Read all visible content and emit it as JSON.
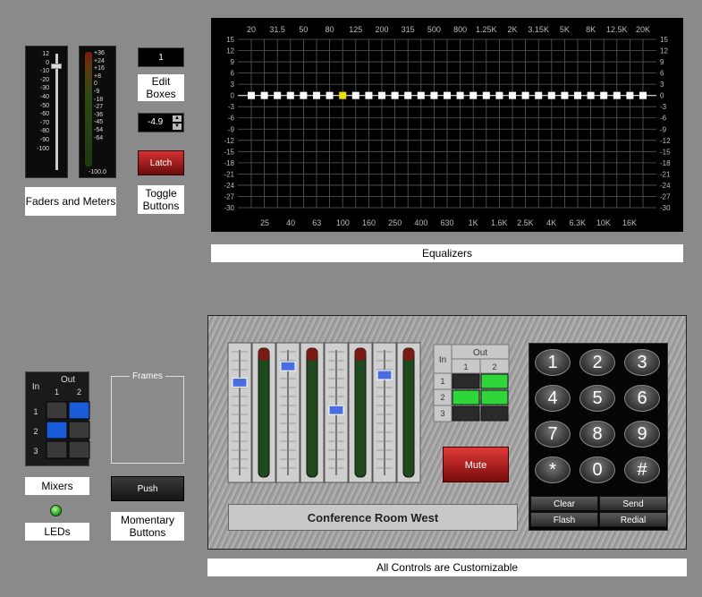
{
  "fader": {
    "scale": [
      "12",
      "0",
      "-10",
      "-20",
      "-30",
      "-40",
      "-50",
      "-60",
      "-70",
      "-80",
      "-90",
      "-100"
    ]
  },
  "meter": {
    "scale": [
      "+36",
      "+24",
      "+16",
      "+8",
      "0",
      "-9",
      "-18",
      "-27",
      "-36",
      "-45",
      "-54",
      "-64"
    ],
    "readout": "-100.0"
  },
  "edit_box": {
    "value": "1"
  },
  "spin_box": {
    "value": "-4.9",
    "up": "▲",
    "down": "▼"
  },
  "toggle": {
    "label": "Latch"
  },
  "labels": {
    "faders_meters": "Faders and Meters",
    "edit_boxes": "Edit Boxes",
    "toggle_buttons": "Toggle Buttons",
    "equalizers": "Equalizers",
    "mixers": "Mixers",
    "leds": "LEDs",
    "momentary_buttons": "Momentary Buttons",
    "all_controls": "All Controls are Customizable"
  },
  "equalizer": {
    "top_freqs": [
      "20",
      "31.5",
      "50",
      "80",
      "125",
      "200",
      "315",
      "500",
      "800",
      "1.25K",
      "2K",
      "3.15K",
      "5K",
      "8K",
      "12.5K",
      "20K"
    ],
    "bottom_freqs": [
      "25",
      "40",
      "63",
      "100",
      "160",
      "250",
      "400",
      "630",
      "1K",
      "1.6K",
      "2.5K",
      "4K",
      "6.3K",
      "10K",
      "16K"
    ],
    "db_scale": [
      "15",
      "12",
      "9",
      "6",
      "3",
      "0",
      "-3",
      "-6",
      "-9",
      "-12",
      "-15",
      "-18",
      "-21",
      "-24",
      "-27",
      "-30"
    ],
    "band_levels_db": [
      0,
      0,
      0,
      0,
      0,
      0,
      0,
      0,
      0,
      0,
      0,
      0,
      0,
      0,
      0,
      0,
      0,
      0,
      0,
      0,
      0,
      0,
      0,
      0,
      0,
      0,
      0,
      0,
      0,
      0,
      0
    ],
    "selected_band": 7,
    "selected_color": "#f0e000",
    "band_color": "#ffffff"
  },
  "small_mixer": {
    "in_label": "In",
    "out_label": "Out",
    "out_cols": [
      "1",
      "2"
    ],
    "in_rows": [
      "1",
      "2",
      "3"
    ],
    "active": [
      [
        false,
        true
      ],
      [
        true,
        false
      ],
      [
        false,
        false
      ]
    ],
    "active_color": "#1a5cd8"
  },
  "frame": {
    "title": "Frames"
  },
  "push_button": {
    "label": "Push"
  },
  "conference": {
    "room_name": "Conference Room West",
    "fader_levels": [
      0.74,
      0.87,
      0.52,
      0.8
    ],
    "matrix": {
      "in_label": "In",
      "out_label": "Out",
      "out_cols": [
        "1",
        "2"
      ],
      "in_rows": [
        "1",
        "2",
        "3"
      ],
      "active": [
        [
          false,
          true
        ],
        [
          true,
          true
        ],
        [
          false,
          false
        ]
      ],
      "active_color": "#2fd63a"
    },
    "mute_label": "Mute",
    "keypad_keys": [
      "1",
      "2",
      "3",
      "4",
      "5",
      "6",
      "7",
      "8",
      "9",
      "*",
      "0",
      "#"
    ],
    "fn_buttons": [
      "Clear",
      "Send",
      "Flash",
      "Redial"
    ]
  }
}
